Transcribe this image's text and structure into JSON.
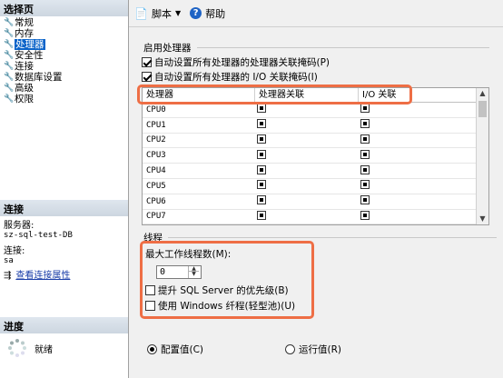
{
  "left": {
    "select_page_header": "选择页",
    "pages": [
      "常规",
      "内存",
      "处理器",
      "安全性",
      "连接",
      "数据库设置",
      "高级",
      "权限"
    ],
    "selected_index": 2,
    "connection_header": "连接",
    "server_label": "服务器:",
    "server_value": "sz-sql-test-DB",
    "connection_label": "连接:",
    "connection_value": "sa",
    "view_conn_link": "查看连接属性",
    "progress_header": "进度",
    "progress_status": "就绪"
  },
  "toolbar": {
    "script_label": "脚本",
    "help_label": "帮助"
  },
  "processors": {
    "group_title": "启用处理器",
    "auto_affinity_label": "自动设置所有处理器的处理器关联掩码(P)",
    "auto_io_affinity_label": "自动设置所有处理器的 I/O 关联掩码(I)",
    "columns": [
      "处理器",
      "处理器关联",
      "I/O 关联"
    ],
    "rows": [
      "CPU0",
      "CPU1",
      "CPU2",
      "CPU3",
      "CPU4",
      "CPU5",
      "CPU6",
      "CPU7"
    ]
  },
  "threads": {
    "group_title": "线程",
    "max_worker_label": "最大工作线程数(M):",
    "max_worker_value": "0",
    "boost_priority_label": "提升 SQL Server 的优先级(B)",
    "lightweight_pooling_label": "使用 Windows 纤程(轻型池)(U)"
  },
  "footer": {
    "configured_label": "配置值(C)",
    "running_label": "运行值(R)"
  }
}
